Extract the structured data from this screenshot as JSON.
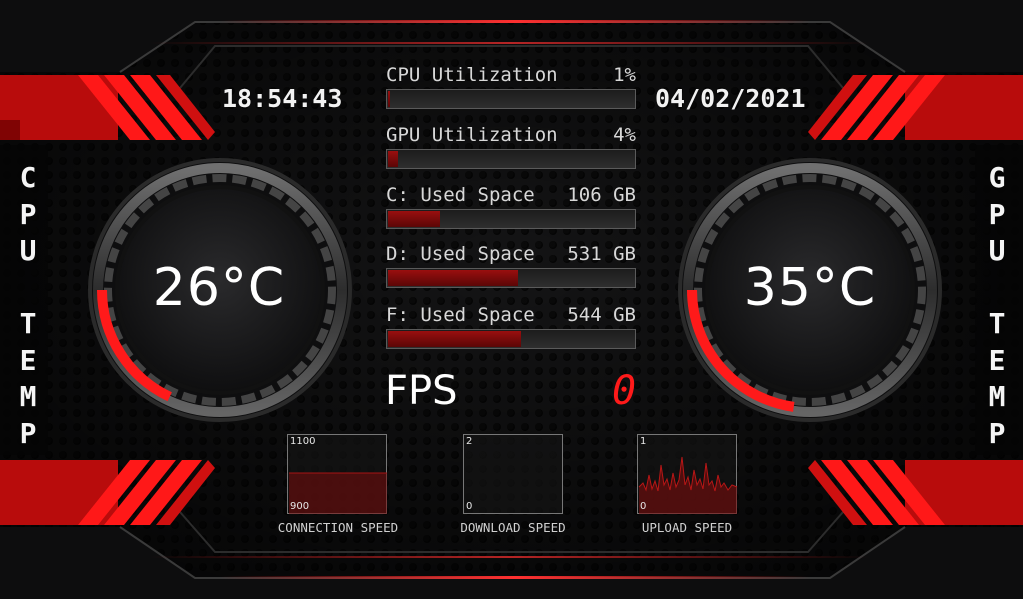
{
  "clock": {
    "time": "18:54:43",
    "date": "04/02/2021"
  },
  "cpu": {
    "side_label": [
      "C",
      "P",
      "U",
      "",
      "T",
      "E",
      "M",
      "P"
    ],
    "temp": "26°C",
    "temp_fraction": 0.3
  },
  "gpu": {
    "side_label": [
      "G",
      "P",
      "U",
      "",
      "T",
      "E",
      "M",
      "P"
    ],
    "temp": "35°C",
    "temp_fraction": 0.38
  },
  "metrics": [
    {
      "label": "CPU Utilization",
      "value": "1%",
      "fraction": 0.01
    },
    {
      "label": "GPU Utilization",
      "value": "4%",
      "fraction": 0.04
    },
    {
      "label": "C: Used Space",
      "value": "106 GB",
      "fraction": 0.21
    },
    {
      "label": "D: Used Space",
      "value": "531 GB",
      "fraction": 0.53
    },
    {
      "label": "F: Used Space",
      "value": "544 GB",
      "fraction": 0.54
    }
  ],
  "fps": {
    "label": "FPS",
    "value": "0"
  },
  "graphs": [
    {
      "caption": "CONNECTION SPEED",
      "max": "1100",
      "min": "900"
    },
    {
      "caption": "DOWNLOAD SPEED",
      "max": "2",
      "min": "0"
    },
    {
      "caption": "UPLOAD SPEED",
      "max": "1",
      "min": "0"
    }
  ],
  "colors": {
    "accent": "#e01010",
    "bar_fill": "#8a0c0c",
    "background": "#0b0b0c",
    "text": "#e9e9e9"
  }
}
